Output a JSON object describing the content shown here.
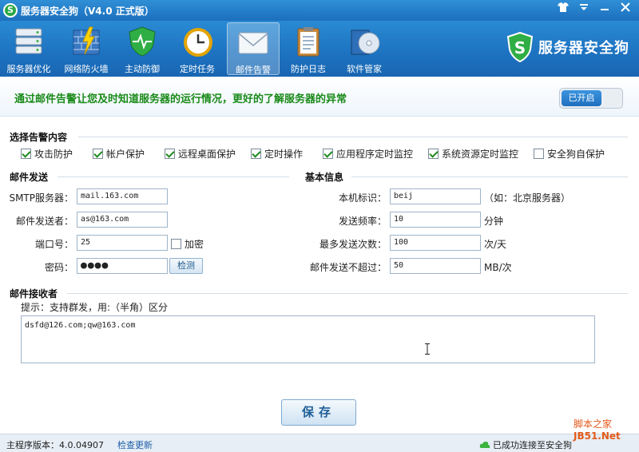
{
  "window": {
    "title": "服务器安全狗（V4.0 正式版）",
    "controls": [
      "skin",
      "menu",
      "minimize",
      "close"
    ]
  },
  "toolbar": {
    "items": [
      {
        "label": "服务器优化",
        "icon": "server-icon"
      },
      {
        "label": "网络防火墙",
        "icon": "firewall-icon"
      },
      {
        "label": "主动防御",
        "icon": "shield-icon"
      },
      {
        "label": "定时任务",
        "icon": "clock-icon"
      },
      {
        "label": "邮件告警",
        "icon": "mail-icon",
        "active": true
      },
      {
        "label": "防护日志",
        "icon": "clipboard-icon"
      },
      {
        "label": "软件管家",
        "icon": "disc-icon"
      }
    ],
    "brand": "服务器安全狗"
  },
  "banner": {
    "text": "通过邮件告警让您及时知道服务器的运行情况，更好的了解服务器的异常",
    "toggle_label": "已开启"
  },
  "alerts": {
    "title": "选择告警内容",
    "options": [
      {
        "label": "攻击防护",
        "checked": true
      },
      {
        "label": "帐户保护",
        "checked": true
      },
      {
        "label": "远程桌面保护",
        "checked": true
      },
      {
        "label": "定时操作",
        "checked": true
      },
      {
        "label": "应用程序定时监控",
        "checked": true
      },
      {
        "label": "系统资源定时监控",
        "checked": true
      },
      {
        "label": "安全狗自保护",
        "checked": false
      }
    ]
  },
  "mail": {
    "title": "邮件发送",
    "smtp_label": "SMTP服务器：",
    "smtp_value": "mail.163.com",
    "sender_label": "邮件发送者：",
    "sender_value": "as@163.com",
    "port_label": "端口号：",
    "port_value": "25",
    "encrypt_label": "加密",
    "encrypt_checked": false,
    "password_label": "密码：",
    "password_value": "●●●●",
    "test_button": "检测"
  },
  "basic": {
    "title": "基本信息",
    "id_label": "本机标识：",
    "id_value": "beij",
    "id_hint": "（如：北京服务器）",
    "freq_label": "发送频率：",
    "freq_value": "10",
    "freq_unit": "分钟",
    "max_label": "最多发送次数：",
    "max_value": "100",
    "max_unit": "次/天",
    "limit_label": "邮件发送不超过：",
    "limit_value": "50",
    "limit_unit": "MB/次"
  },
  "receivers": {
    "title": "邮件接收者",
    "hint": "提示：支持群发，用:（半角）区分",
    "value": "dsfd@126.com;qw@163.com"
  },
  "actions": {
    "save": "保存"
  },
  "status": {
    "version": "主程序版本：4.0.04907",
    "check_update": "检查更新",
    "connection": "已成功连接至安全狗"
  },
  "watermark": {
    "line1": "脚本之家",
    "line2": "JB51.Net"
  }
}
